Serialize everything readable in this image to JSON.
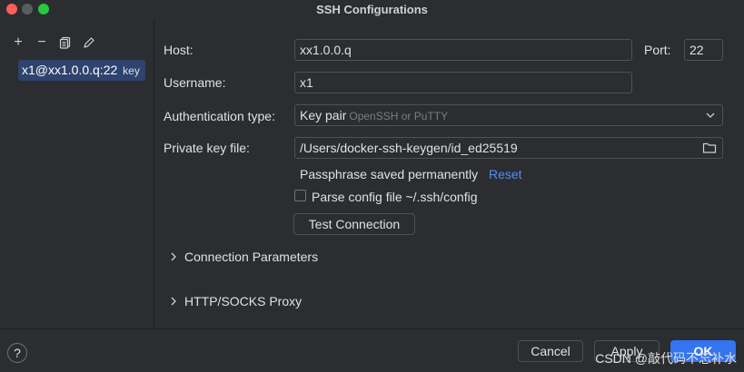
{
  "window": {
    "title": "SSH Configurations"
  },
  "sidebar": {
    "toolbar": [
      {
        "icon": "plus-icon",
        "glyph": "+"
      },
      {
        "icon": "minus-icon",
        "glyph": "−"
      },
      {
        "icon": "copy-icon"
      },
      {
        "icon": "edit-icon"
      }
    ],
    "items": [
      {
        "label": "x1@xx1.0.0.q:22",
        "tag": "key"
      }
    ]
  },
  "form": {
    "host_label": "Host:",
    "host_value": "xx1.0.0.q",
    "port_label": "Port:",
    "port_value": "22",
    "username_label": "Username:",
    "username_value": "x1",
    "auth_label": "Authentication type:",
    "auth_value": "Key pair",
    "auth_hint": "OpenSSH or PuTTY",
    "key_label": "Private key file:",
    "key_value": "/Users/docker-ssh-keygen/id_ed25519",
    "passphrase_text": "Passphrase saved permanently",
    "reset_label": "Reset",
    "parse_config_label": "Parse config file ~/.ssh/config",
    "parse_config_checked": false,
    "test_connection_label": "Test Connection"
  },
  "sections": [
    {
      "label": "Connection Parameters",
      "expanded": false
    },
    {
      "label": "HTTP/SOCKS Proxy",
      "expanded": false
    }
  ],
  "footer": {
    "help_label": "?",
    "cancel_label": "Cancel",
    "apply_label": "Apply",
    "ok_label": "OK",
    "watermark": "CSDN @敲代码不忘补水"
  },
  "colors": {
    "accent": "#3574f0",
    "link": "#548af7",
    "selection": "#2e436e",
    "background": "#2b2d30"
  }
}
